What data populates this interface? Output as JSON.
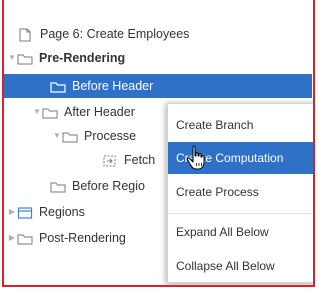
{
  "tree": {
    "page_title": "Page 6: Create Employees",
    "pre_rendering": "Pre-Rendering",
    "before_header": "Before Header",
    "after_header": "After Header",
    "processes": "Processe",
    "fetch": "Fetch",
    "before_regions": "Before Regio",
    "regions": "Regions",
    "post_rendering": "Post-Rendering"
  },
  "context_menu": {
    "items": [
      {
        "label": "Create Branch"
      },
      {
        "label": "Create Computation"
      },
      {
        "label": "Create Process"
      },
      {
        "label": "Expand All Below"
      },
      {
        "label": "Collapse All Below"
      }
    ],
    "active_index": 1
  },
  "colors": {
    "selection": "#2f71c7",
    "frame_border": "#d8232a"
  },
  "icons": {
    "page": "page-icon",
    "folder": "folder-icon",
    "regions": "regions-icon",
    "fetch": "fetch-icon",
    "cursor": "hand-pointer-icon"
  }
}
